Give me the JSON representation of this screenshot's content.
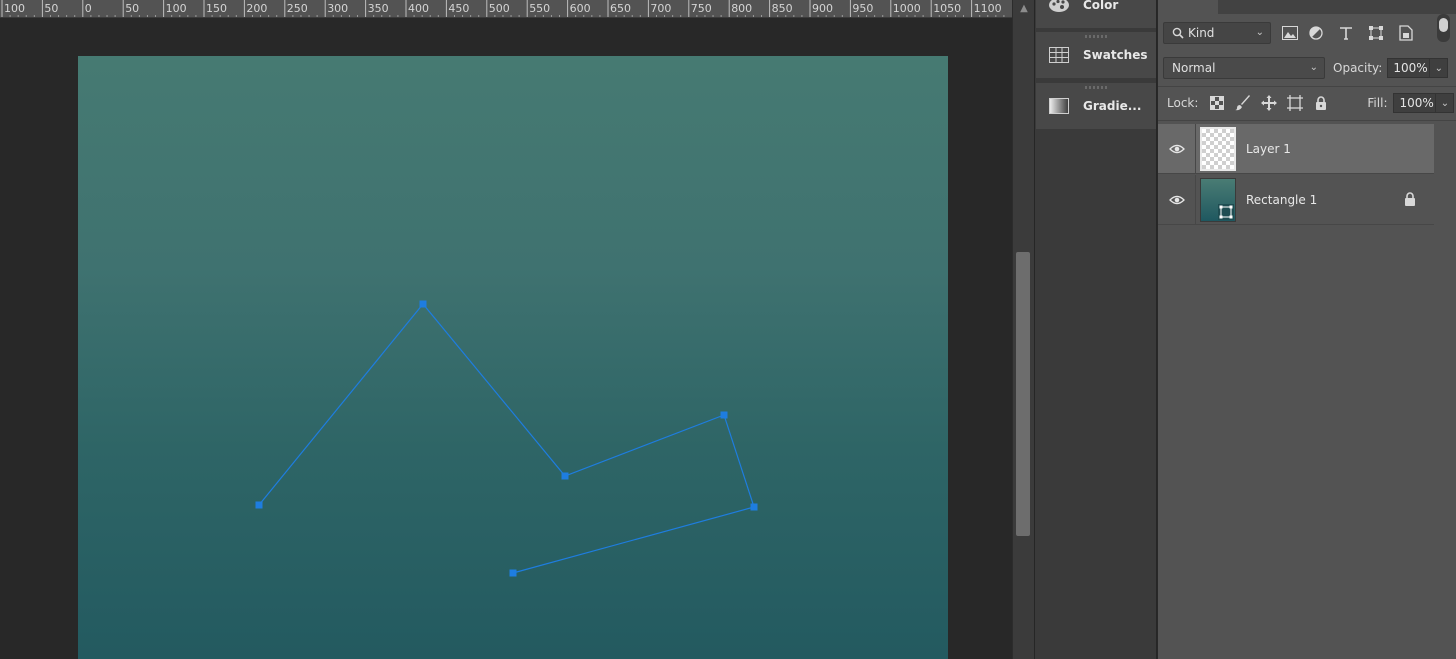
{
  "ruler": {
    "labels": [
      "100",
      "50",
      "0",
      "50",
      "100",
      "150",
      "200",
      "250",
      "300",
      "350",
      "400",
      "450",
      "500",
      "550",
      "600",
      "650",
      "700",
      "750",
      "800",
      "850",
      "900",
      "950",
      "1000",
      "1050",
      "1100"
    ]
  },
  "collapsed_panels": [
    {
      "label": "Color",
      "icon": "palette-icon"
    },
    {
      "label": "Swatches",
      "icon": "swatches-grid-icon"
    },
    {
      "label": "Gradie...",
      "icon": "gradient-icon"
    }
  ],
  "layers": {
    "filter": {
      "kind_label": "Kind"
    },
    "blend_mode": "Normal",
    "opacity_label": "Opacity:",
    "opacity_value": "100%",
    "lock_label": "Lock:",
    "fill_label": "Fill:",
    "fill_value": "100%",
    "items": [
      {
        "name": "Layer 1",
        "selected": true,
        "locked": false
      },
      {
        "name": "Rectangle 1",
        "selected": false,
        "locked": true
      }
    ]
  },
  "colors": {
    "path_stroke": "#1e7de0",
    "selected_layer": "#696969",
    "panel_bg": "#535353"
  }
}
